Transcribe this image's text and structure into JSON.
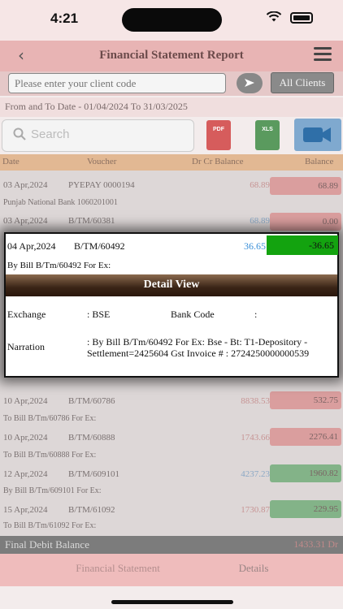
{
  "status": {
    "time": "4:21"
  },
  "nav": {
    "title": "Financial Statement Report",
    "back_icon": "‹",
    "menu_icon": "hamburger-icon"
  },
  "client": {
    "placeholder": "Please enter your client code",
    "go_icon": "arrow-right-icon",
    "all_clients_label": "All Clients"
  },
  "date_range": "From and To Date - 01/04/2024 To 31/03/2025",
  "search": {
    "placeholder": "Search"
  },
  "exports": {
    "pdf": "PDF",
    "xls": "XLS"
  },
  "columns": {
    "date": "Date",
    "voucher": "Voucher",
    "drcr": "Dr Cr Balance",
    "balance": "Balance"
  },
  "rows": [
    {
      "date": "03 Apr,2024",
      "voucher": "PYEPAY 0000194",
      "amount": "68.89",
      "balance": "68.89",
      "sub": "Punjab National Bank 1060201001"
    },
    {
      "date": "03 Apr,2024",
      "voucher": "B/TM/60381",
      "amount": "68.89",
      "balance": "0.00",
      "sub": ""
    },
    {
      "date": "10 Apr,2024",
      "voucher": "B/TM/60786",
      "amount": "8838.53",
      "balance": "532.75",
      "sub": "To Bill B/Tm/60786     For Ex:"
    },
    {
      "date": "10 Apr,2024",
      "voucher": "B/TM/60888",
      "amount": "1743.66",
      "balance": "2276.41",
      "sub": "To Bill B/Tm/60888     For Ex:"
    },
    {
      "date": "12 Apr,2024",
      "voucher": "B/TM/609101",
      "amount": "4237.23",
      "balance": "1960.82",
      "sub": "By Bill B/Tm/609101     For Ex:"
    },
    {
      "date": "15 Apr,2024",
      "voucher": "B/TM/61092",
      "amount": "1730.87",
      "balance": "229.95",
      "sub": "To Bill B/Tm/61092     For Ex:"
    }
  ],
  "modal": {
    "date": "04 Apr,2024",
    "voucher": "B/TM/60492",
    "amount": "36.65",
    "balance": "-36.65",
    "sub": "By Bill B/Tm/60492     For Ex:",
    "title": "Detail View",
    "exchange_label": "Exchange",
    "exchange_value": ": BSE",
    "bankcode_label": "Bank Code",
    "bankcode_value": ":",
    "narration_label": "Narration",
    "narration_value": ": By Bill B/Tm/60492     For Ex: Bse - Bt: T1-Depository - Settlement=2425604 Gst Invoice # : 2724250000000539"
  },
  "footer": {
    "label": "Final Debit Balance",
    "value": "1433.31 Dr"
  },
  "tabs": {
    "statement": "Financial Statement",
    "details": "Details"
  },
  "colors": {
    "modal_green": "#13a30f",
    "amount_blue": "#3a8fd8",
    "header_brown": "#3a2416"
  }
}
